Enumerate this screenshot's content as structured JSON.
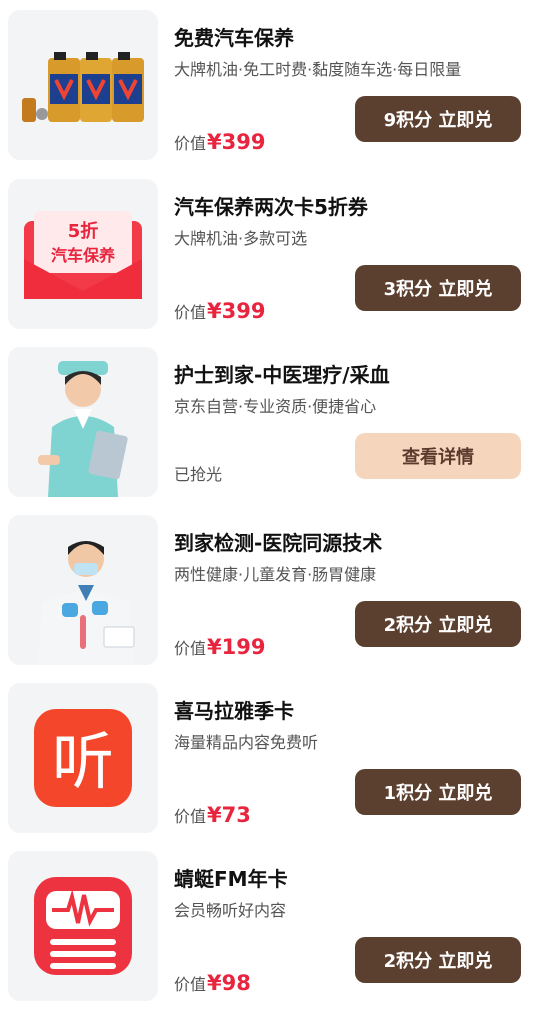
{
  "items": [
    {
      "title": "免费汽车保养",
      "subtitle": "大牌机油·免工时费·黏度随车选·每日限量",
      "price_label": "价值",
      "price": "¥399",
      "button": "9积分 立即兑",
      "image": "motor-oil-image",
      "status": ""
    },
    {
      "title": "汽车保养两次卡5折券",
      "subtitle": "大牌机油·多款可选",
      "price_label": "价值",
      "price": "¥399",
      "button": "3积分 立即兑",
      "image": "coupon-envelope-image",
      "coupon_line1": "5折",
      "coupon_line2": "汽车保养",
      "status": ""
    },
    {
      "title": "护士到家-中医理疗/采血",
      "subtitle": "京东自营·专业资质·便捷省心",
      "price_label": "",
      "price": "",
      "button": "查看详情",
      "image": "nurse-image",
      "status": "已抢光"
    },
    {
      "title": "到家检测-医院同源技术",
      "subtitle": "两性健康·儿童发育·肠胃健康",
      "price_label": "价值",
      "price": "¥199",
      "button": "2积分 立即兑",
      "image": "lab-technician-image",
      "status": ""
    },
    {
      "title": "喜马拉雅季卡",
      "subtitle": "海量精品内容免费听",
      "price_label": "价值",
      "price": "¥73",
      "button": "1积分 立即兑",
      "image": "ximalaya-logo",
      "logo_text": "听",
      "status": ""
    },
    {
      "title": "蜻蜓FM年卡",
      "subtitle": "会员畅听好内容",
      "price_label": "价值",
      "price": "¥98",
      "button": "2积分 立即兑",
      "image": "qingting-fm-logo",
      "status": ""
    }
  ],
  "colors": {
    "accent_price": "#e8243e",
    "button_dark": "#5b3f2f",
    "button_light": "#f6d5bd",
    "thumb_bg": "#f3f4f6"
  }
}
